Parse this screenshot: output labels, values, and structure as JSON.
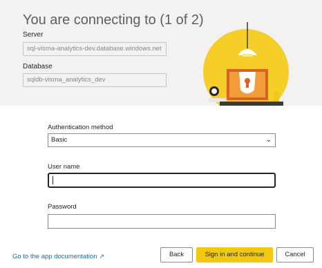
{
  "header": {
    "title": "You are connecting to (1 of 2)",
    "server_label": "Server",
    "server_value": "sql-visma-analytics-dev.database.windows.net",
    "database_label": "Database",
    "database_value": "sqldb-visma_analytics_dev"
  },
  "form": {
    "auth_label": "Authentication method",
    "auth_value": "Basic",
    "username_label": "User name",
    "username_value": "",
    "password_label": "Password",
    "password_value": ""
  },
  "footer": {
    "doc_link": "Go to the app documentation",
    "back_label": "Back",
    "signin_label": "Sign in and continue",
    "cancel_label": "Cancel"
  },
  "colors": {
    "accent": "#f2c811",
    "link": "#0f6cbd",
    "header_bg": "#f3f2f1"
  }
}
